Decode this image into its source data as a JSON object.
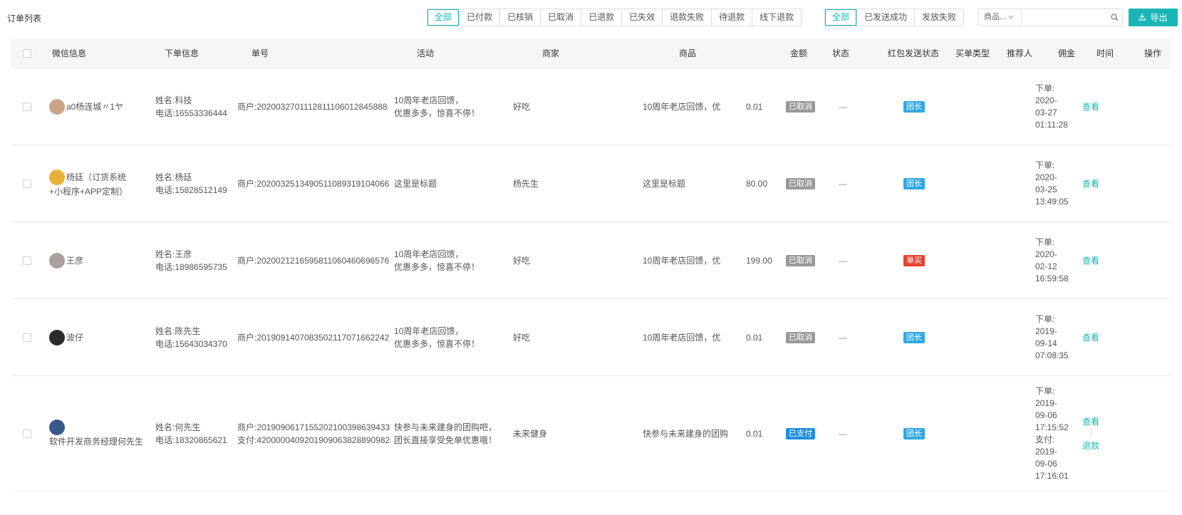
{
  "page_title": "订单列表",
  "status_filters": [
    "全部",
    "已付款",
    "已核销",
    "已取消",
    "已退款",
    "已失效",
    "退款失败",
    "待退款",
    "线下退款"
  ],
  "status_active": 0,
  "packet_filters": [
    "全部",
    "已发送成功",
    "发放失败"
  ],
  "packet_active": 0,
  "search": {
    "field_label": "商品...",
    "value": "",
    "placeholder": ""
  },
  "export_label": "导出",
  "columns": {
    "wechat": "微信信息",
    "order_info": "下单信息",
    "order_no": "单号",
    "activity": "活动",
    "merchant": "商家",
    "goods": "商品",
    "amount": "金额",
    "status": "状态",
    "packet_status": "红包发送状态",
    "buy_type": "买单类型",
    "referrer": "推荐人",
    "commission": "佣金",
    "time": "时间",
    "action": "操作"
  },
  "colors": {
    "accent": "#19b5b5",
    "status_cancel": "#999999",
    "status_paid": "#1e8fe0",
    "type_leader": "#2fa8e6",
    "type_single": "#e8412f"
  },
  "rows": [
    {
      "nickname": [
        "a0杨连城〃1ヤ"
      ],
      "avatar_color": "#c9a58a",
      "name": "姓名:科技",
      "phone": "电话:16553336444",
      "order_no": [
        "商户:2020032701112811106012845888"
      ],
      "activity": [
        "10周年老店回馈，",
        "优惠多多，惊喜不停！"
      ],
      "merchant": "好吃",
      "goods": "10周年老店回馈，优",
      "amount": "0.01",
      "status": "已取消",
      "status_kind": "cancel",
      "packet_status": "—",
      "buy_type": "团长",
      "buy_type_kind": "leader",
      "referrer": "",
      "commission": "",
      "time": [
        "下单:",
        "2020-",
        "03-27",
        "01:11:28"
      ],
      "actions": [
        "查看"
      ]
    },
    {
      "nickname": [
        "杨廷（订货系统",
        "+小程序+APP定制）"
      ],
      "avatar_color": "#e8b13a",
      "name": "姓名:杨廷",
      "phone": "电话:15828512149",
      "order_no": [
        "商户:2020032513490511089319104066"
      ],
      "activity": [
        "这里是标题"
      ],
      "merchant": "杨先生",
      "goods": "这里是标题",
      "amount": "80.00",
      "status": "已取消",
      "status_kind": "cancel",
      "packet_status": "—",
      "buy_type": "团长",
      "buy_type_kind": "leader",
      "referrer": "",
      "commission": "",
      "time": [
        "下单:",
        "2020-",
        "03-25",
        "13:49:05"
      ],
      "actions": [
        "查看"
      ]
    },
    {
      "nickname": [
        "王彦"
      ],
      "avatar_color": "#a8a29a",
      "name": "姓名:王彦",
      "phone": "电话:18986595735",
      "order_no": [
        "商户:2020021216595811060460696576"
      ],
      "activity": [
        "10周年老店回馈，",
        "优惠多多，惊喜不停！"
      ],
      "merchant": "好吃",
      "goods": "10周年老店回馈，优",
      "amount": "199.00",
      "status": "已取消",
      "status_kind": "cancel",
      "packet_status": "—",
      "buy_type": "单买",
      "buy_type_kind": "single",
      "referrer": "",
      "commission": "",
      "time": [
        "下单:",
        "2020-",
        "02-12",
        "16:59:58"
      ],
      "actions": [
        "查看"
      ]
    },
    {
      "nickname": [
        "波仔"
      ],
      "avatar_color": "#2b2b2b",
      "name": "姓名:陈先生",
      "phone": "电话:15643034370",
      "order_no": [
        "商户:2019091407083502117071662242"
      ],
      "activity": [
        "10周年老店回馈，",
        "优惠多多，惊喜不停！"
      ],
      "merchant": "好吃",
      "goods": "10周年老店回馈，优",
      "amount": "0.01",
      "status": "已取消",
      "status_kind": "cancel",
      "packet_status": "—",
      "buy_type": "团长",
      "buy_type_kind": "leader",
      "referrer": "",
      "commission": "",
      "time": [
        "下单:",
        "2019-",
        "09-14",
        "07:08:35"
      ],
      "actions": [
        "查看"
      ]
    },
    {
      "nickname": [
        "软件开发商务经理何先生"
      ],
      "avatar_color": "#3a5a8a",
      "name": "姓名:何先生",
      "phone": "电话:18320865621",
      "order_no": [
        "商户:2019090617155202100398639433",
        "支付:4200000409201909063828890982"
      ],
      "activity": [
        "快参与未来建身的团购吧，",
        "团长直接享受免单优惠哦！"
      ],
      "merchant": "未来健身",
      "goods": "快参与未来建身的团购",
      "amount": "0.01",
      "status": "已支付",
      "status_kind": "paid",
      "packet_status": "—",
      "buy_type": "团长",
      "buy_type_kind": "leader",
      "referrer": "",
      "commission": "",
      "time": [
        "下单:",
        "2019-",
        "09-06",
        "17:15:52",
        "支付:",
        "2019-",
        "09-06",
        "17:16:01"
      ],
      "actions": [
        "查看",
        "退款"
      ]
    }
  ]
}
